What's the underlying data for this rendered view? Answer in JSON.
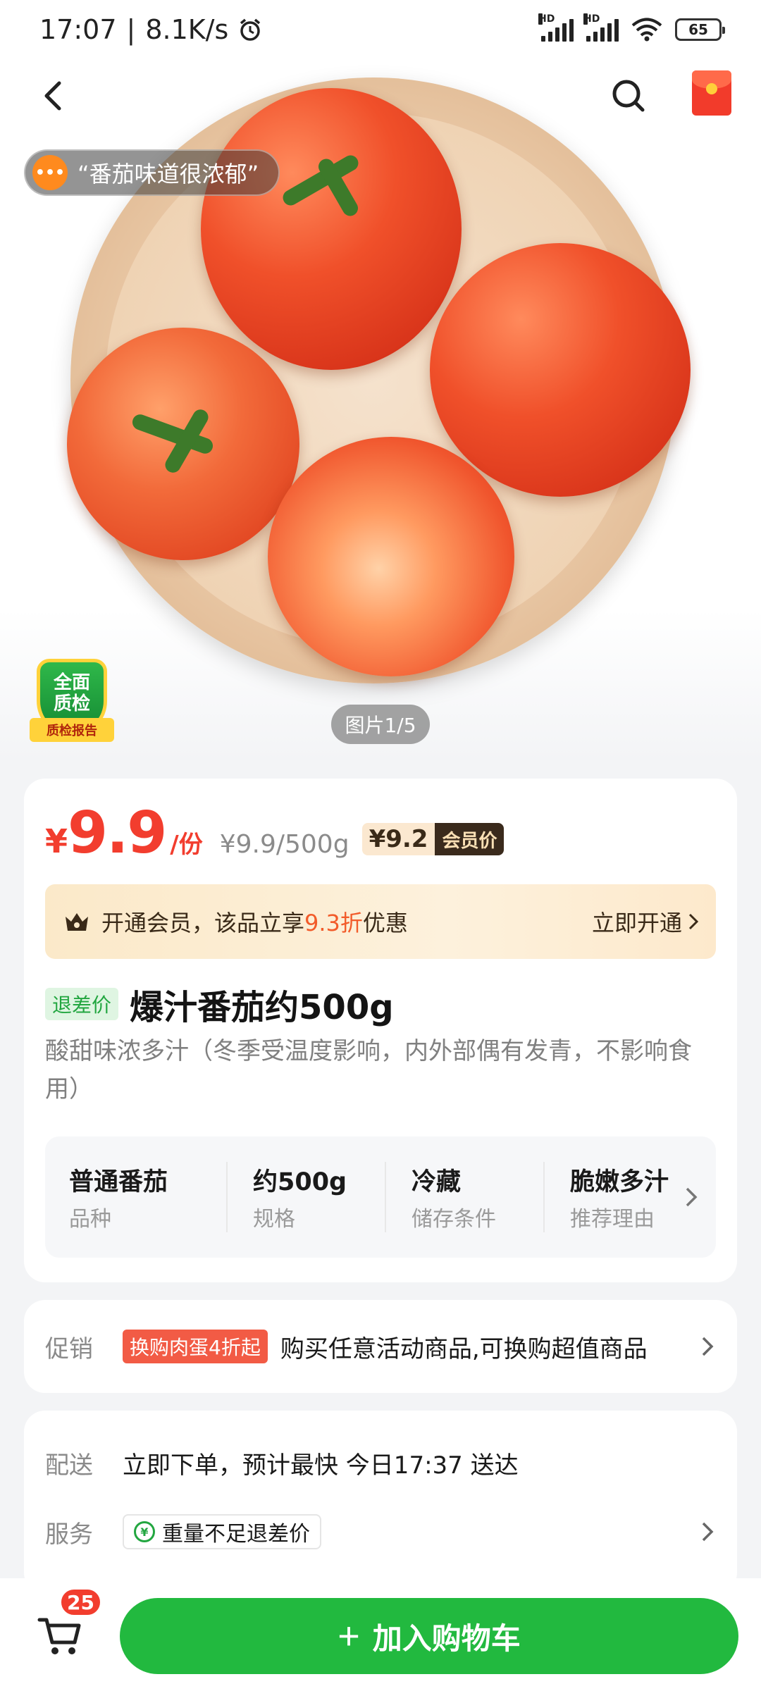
{
  "status_bar": {
    "time": "17:07",
    "net_speed": "8.1K/s",
    "battery": "65",
    "sim1_label": "HD",
    "sim2_label": "HD"
  },
  "header": {
    "back_icon": "chevron-left-icon",
    "search_icon": "search-icon",
    "red_packet_icon": "red-packet-icon"
  },
  "hero": {
    "review_quote": "“番茄味道很浓郁”",
    "quality_badge_top": "全面",
    "quality_badge_mid": "质检",
    "quality_badge_ribbon": "质检报告",
    "image_counter": "图片1/5"
  },
  "price": {
    "currency": "¥",
    "amount": "9.9",
    "unit": "/份",
    "unit_price": "¥9.9/500g",
    "member_price": "¥9.2",
    "member_tag": "会员价"
  },
  "member_banner": {
    "text_before": "开通会员，该品立享",
    "discount": "9.3折",
    "text_after": "优惠",
    "link": "立即开通"
  },
  "product": {
    "tag": "退差价",
    "title": "爆汁番茄约500g",
    "description": "酸甜味浓多汁（冬季受温度影响，内外部偶有发青，不影响食用）"
  },
  "attributes": [
    {
      "value": "普通番茄",
      "key": "品种"
    },
    {
      "value": "约500g",
      "key": "规格"
    },
    {
      "value": "冷藏",
      "key": "储存条件"
    },
    {
      "value": "脆嫩多汁",
      "key": "推荐理由"
    }
  ],
  "promo": {
    "label": "促销",
    "tag": "换购肉蛋4折起",
    "text": "购买任意活动商品,可换购超值商品"
  },
  "delivery": {
    "label": "配送",
    "text": "立即下单，预计最快 今日17:37 送达",
    "service_label": "服务",
    "service_chip": "重量不足退差价"
  },
  "bottom": {
    "cart_count": "25",
    "add_to_cart": "加入购物车"
  },
  "colors": {
    "brand_green": "#22b93f",
    "price_red": "#f23d2e",
    "member_dark": "#3a2a1c"
  }
}
